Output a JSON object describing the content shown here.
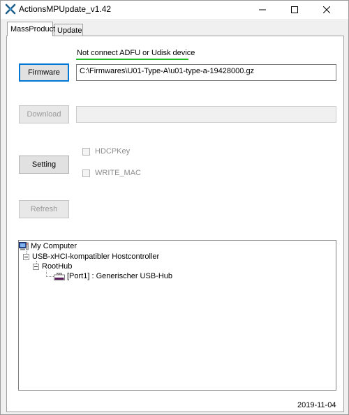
{
  "window": {
    "title": "ActionsMPUpdate_v1.42"
  },
  "tabs": [
    {
      "label": "MassProduct",
      "active": true
    },
    {
      "label": "Update",
      "active": false
    }
  ],
  "status": {
    "text": "Not connect ADFU or Udisk device",
    "underline_color": "#22bb22"
  },
  "buttons": {
    "firmware": "Firmware",
    "download": "Download",
    "setting": "Setting",
    "refresh": "Refresh"
  },
  "inputs": {
    "firmware_path": "C:\\Firmwares\\U01-Type-A\\u01-type-a-19428000.gz",
    "download_value": ""
  },
  "checkboxes": [
    {
      "label": "HDCPKey",
      "checked": false,
      "enabled": false
    },
    {
      "label": "WRITE_MAC",
      "checked": false,
      "enabled": false
    }
  ],
  "tree": {
    "root": "My Computer",
    "controller": "USB-xHCI-kompatibler Hostcontroller",
    "hub": "RootHub",
    "port": "[Port1] : Generischer USB-Hub"
  },
  "footer": {
    "date": "2019-11-04"
  },
  "colors": {
    "accent": "#0078d7",
    "app_icon": "#1f5f8b"
  }
}
